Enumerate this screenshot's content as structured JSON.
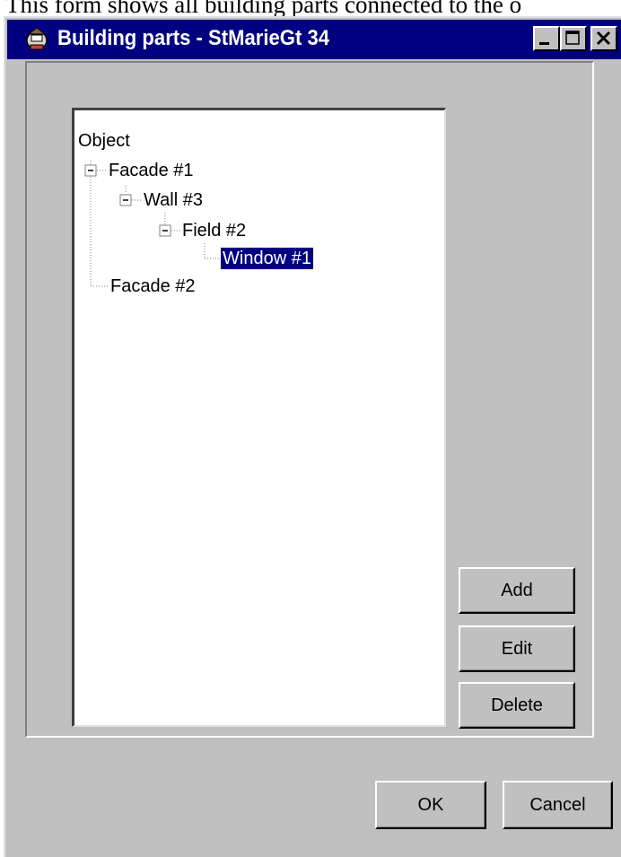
{
  "caption": "This form shows all building parts connected to the o",
  "window": {
    "title": "Building parts - StMarieGt 34",
    "controls": [
      "minimize-icon",
      "maximize-icon",
      "close-icon"
    ]
  },
  "tree": {
    "root": "Object",
    "nodes": [
      {
        "label": "Facade #1",
        "expanded": true
      },
      {
        "label": "Wall #3",
        "expanded": true
      },
      {
        "label": "Field #2",
        "expanded": true
      },
      {
        "label": "Window #1",
        "selected": true
      },
      {
        "label": "Facade #2"
      }
    ]
  },
  "buttons": {
    "add": "Add",
    "edit": "Edit",
    "delete": "Delete",
    "ok": "OK",
    "cancel": "Cancel"
  },
  "colors": {
    "title_bar": "#000080",
    "face": "#c0c0c0",
    "selection": "#000080"
  }
}
